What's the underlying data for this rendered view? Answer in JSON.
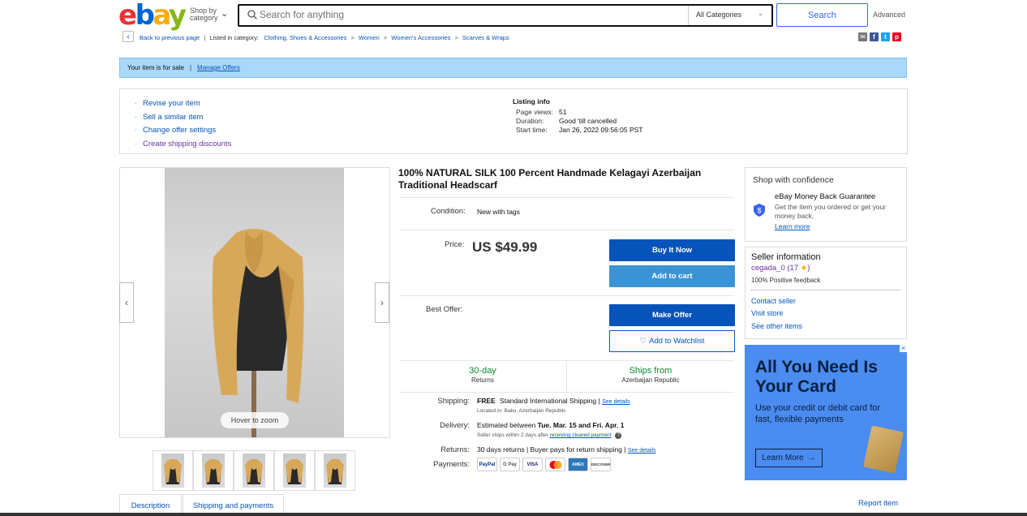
{
  "header": {
    "logo_letters": [
      "e",
      "b",
      "a",
      "y"
    ],
    "shop_by_line1": "Shop by",
    "shop_by_line2": "category",
    "search_placeholder": "Search for anything",
    "category_select": "All Categories",
    "search_button": "Search",
    "advanced_link": "Advanced"
  },
  "breadcrumb": {
    "back": "Back to previous page",
    "listed_in": "Listed in category:",
    "items": [
      "Clothing, Shoes & Accessories",
      "Women",
      "Women's Accessories",
      "Scarves & Wraps"
    ]
  },
  "sale_bar": {
    "status": "Your item is for sale",
    "separator": "|",
    "manage_offers": "Manage Offers"
  },
  "seller_tools": {
    "links": [
      "Revise your item",
      "Sell a similar item",
      "Change offer settings",
      "Create shipping discounts"
    ]
  },
  "listing_info": {
    "heading": "Listing info",
    "rows": [
      {
        "key": "Page views:",
        "value": "51"
      },
      {
        "key": "Duration:",
        "value": "Good 'till cancelled"
      },
      {
        "key": "Start time:",
        "value": "Jan 26, 2022 09:56:05 PST"
      }
    ]
  },
  "gallery": {
    "zoom_hint": "Hover to zoom",
    "thumbnail_count": 5
  },
  "item": {
    "title": "100% NATURAL SILK 100 Percent Handmade Kelagayi Azerbaijan Traditional Headscarf",
    "condition_label": "Condition:",
    "condition_value": "New with tags",
    "price_label": "Price:",
    "price_value": "US $49.99",
    "buy_now": "Buy It Now",
    "add_to_cart": "Add to cart",
    "best_offer_label": "Best Offer:",
    "make_offer": "Make Offer",
    "add_to_watchlist": "Add to Watchlist",
    "returns_big": "30-day",
    "returns_small": "Returns",
    "ships_big": "Ships from",
    "ships_small": "Azerbaijan Republic"
  },
  "details": {
    "shipping_label": "Shipping:",
    "shipping_free": "FREE",
    "shipping_value": "Standard International Shipping |",
    "shipping_see": "See details",
    "shipping_location": "Located in: Baku, Azerbaijan Republic",
    "delivery_label": "Delivery:",
    "delivery_value_pre": "Estimated between",
    "delivery_dates": "Tue. Mar. 15 and Fri. Apr. 1",
    "delivery_note_pre": "Seller ships within 2 days after",
    "delivery_note_link": "receiving cleared payment",
    "returns_label": "Returns:",
    "returns_value": "30 days returns | Buyer pays for return shipping |",
    "returns_see": "See details",
    "payments_label": "Payments:",
    "payment_methods": [
      "PayPal",
      "G Pay",
      "VISA",
      "MC",
      "AMEX",
      "DISCOVER"
    ]
  },
  "confidence": {
    "title": "Shop with confidence",
    "mbg_title": "eBay Money Back Guarantee",
    "mbg_sub": "Get the item you ordered or get your money back.",
    "learn_more": "Learn more"
  },
  "seller": {
    "title": "Seller information",
    "name": "cegada_0 (17",
    "name_close": ")",
    "feedback": "100% Positive feedback",
    "links": [
      "Contact seller",
      "Visit store",
      "See other items"
    ]
  },
  "ad": {
    "headline": "All You Need Is Your Card",
    "sub": "Use your credit or debit card for fast, flexible payments",
    "button": "Learn More",
    "background": "#4a8cf0"
  },
  "tabs": [
    "Description",
    "Shipping and payments"
  ],
  "report_item": "Report item"
}
